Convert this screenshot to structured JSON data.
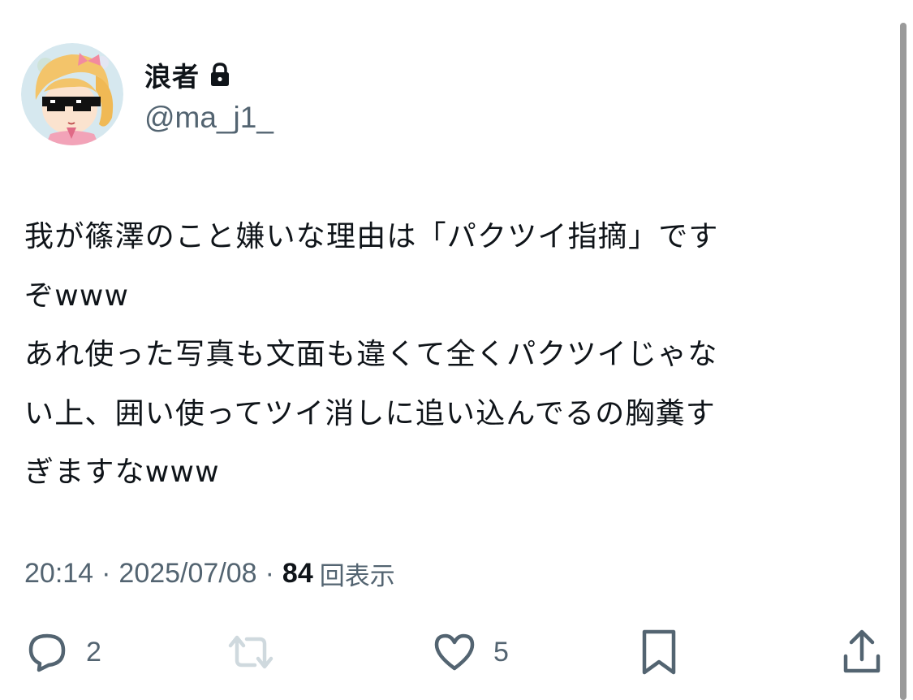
{
  "author": {
    "display_name": "浪者",
    "handle": "@ma_j1_",
    "avatar_icon": "avatar-image",
    "protected_icon": "lock-icon"
  },
  "tweet": {
    "lines": [
      "我が篠澤のこと嫌いな理由は「パクツイ指摘」です",
      "ぞwww",
      "あれ使った写真も文面も違くて全くパクツイじゃな",
      "い上、囲い使ってツイ消しに追い込んでるの胸糞す",
      "ぎますなwww"
    ]
  },
  "meta": {
    "time": "20:14",
    "separator": "·",
    "date": "2025/07/08",
    "views_count": "84",
    "views_label": "回表示"
  },
  "actions": {
    "reply": {
      "icon": "reply-icon",
      "count": "2"
    },
    "retweet": {
      "icon": "retweet-icon",
      "count": ""
    },
    "like": {
      "icon": "heart-icon",
      "count": "5"
    },
    "bookmark": {
      "icon": "bookmark-icon"
    },
    "share": {
      "icon": "share-icon"
    }
  },
  "colors": {
    "text_primary": "#0f1419",
    "text_secondary": "#536471",
    "retweet_disabled": "#cfd9de",
    "background": "#ffffff"
  }
}
